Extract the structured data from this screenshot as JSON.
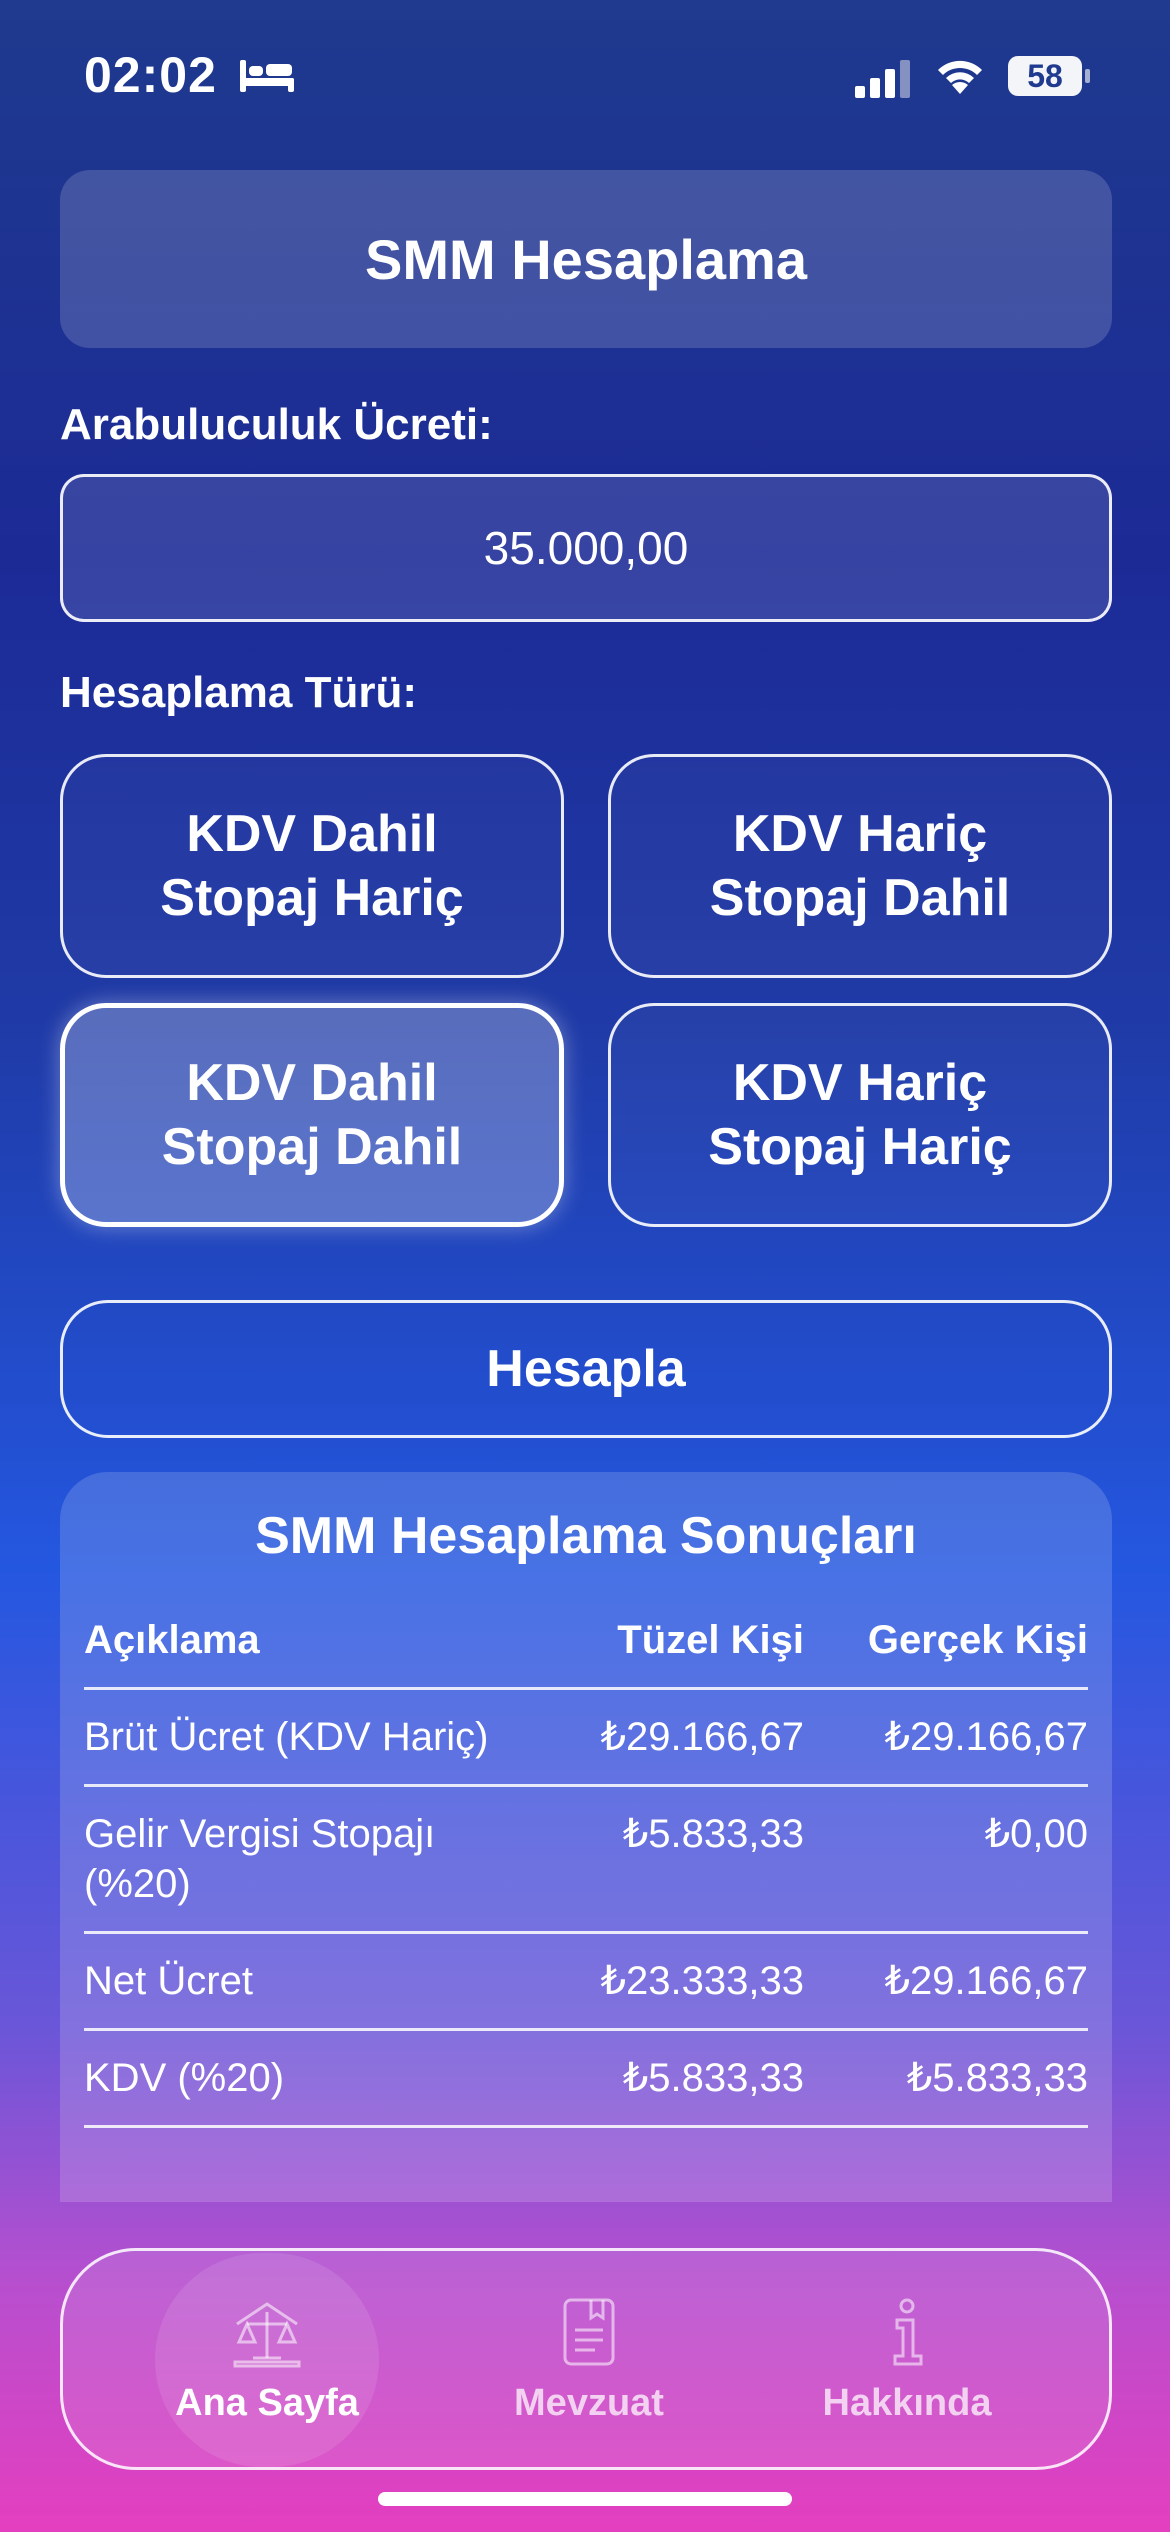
{
  "status_bar": {
    "time": "02:02",
    "battery": "58"
  },
  "header": {
    "title": "SMM Hesaplama"
  },
  "fee": {
    "label": "Arabuluculuk Ücreti:",
    "value": "35.000,00"
  },
  "calc_type": {
    "label": "Hesaplama Türü:",
    "options": [
      {
        "line1": "KDV Dahil",
        "line2": "Stopaj Hariç"
      },
      {
        "line1": "KDV Hariç",
        "line2": "Stopaj Dahil"
      },
      {
        "line1": "KDV Dahil",
        "line2": "Stopaj Dahil"
      },
      {
        "line1": "KDV Hariç",
        "line2": "Stopaj Hariç"
      }
    ],
    "selected": "KDV Dahil Stopaj Dahil"
  },
  "calculate_button": "Hesapla",
  "results": {
    "title": "SMM Hesaplama Sonuçları",
    "columns": [
      "Açıklama",
      "Tüzel Kişi",
      "Gerçek Kişi"
    ],
    "rows": [
      [
        "Brüt Ücret (KDV Hariç)",
        "₺29.166,67",
        "₺29.166,67"
      ],
      [
        "Gelir Vergisi Stopajı (%20)",
        "₺5.833,33",
        "₺0,00"
      ],
      [
        "Net Ücret",
        "₺23.333,33",
        "₺29.166,67"
      ],
      [
        "KDV (%20)",
        "₺5.833,33",
        "₺5.833,33"
      ]
    ]
  },
  "tab_bar": {
    "tabs": [
      {
        "label": "Ana Sayfa",
        "icon": "scales-icon",
        "active": true
      },
      {
        "label": "Mevzuat",
        "icon": "document-icon",
        "active": false
      },
      {
        "label": "Hakkında",
        "icon": "info-icon",
        "active": false
      }
    ]
  }
}
